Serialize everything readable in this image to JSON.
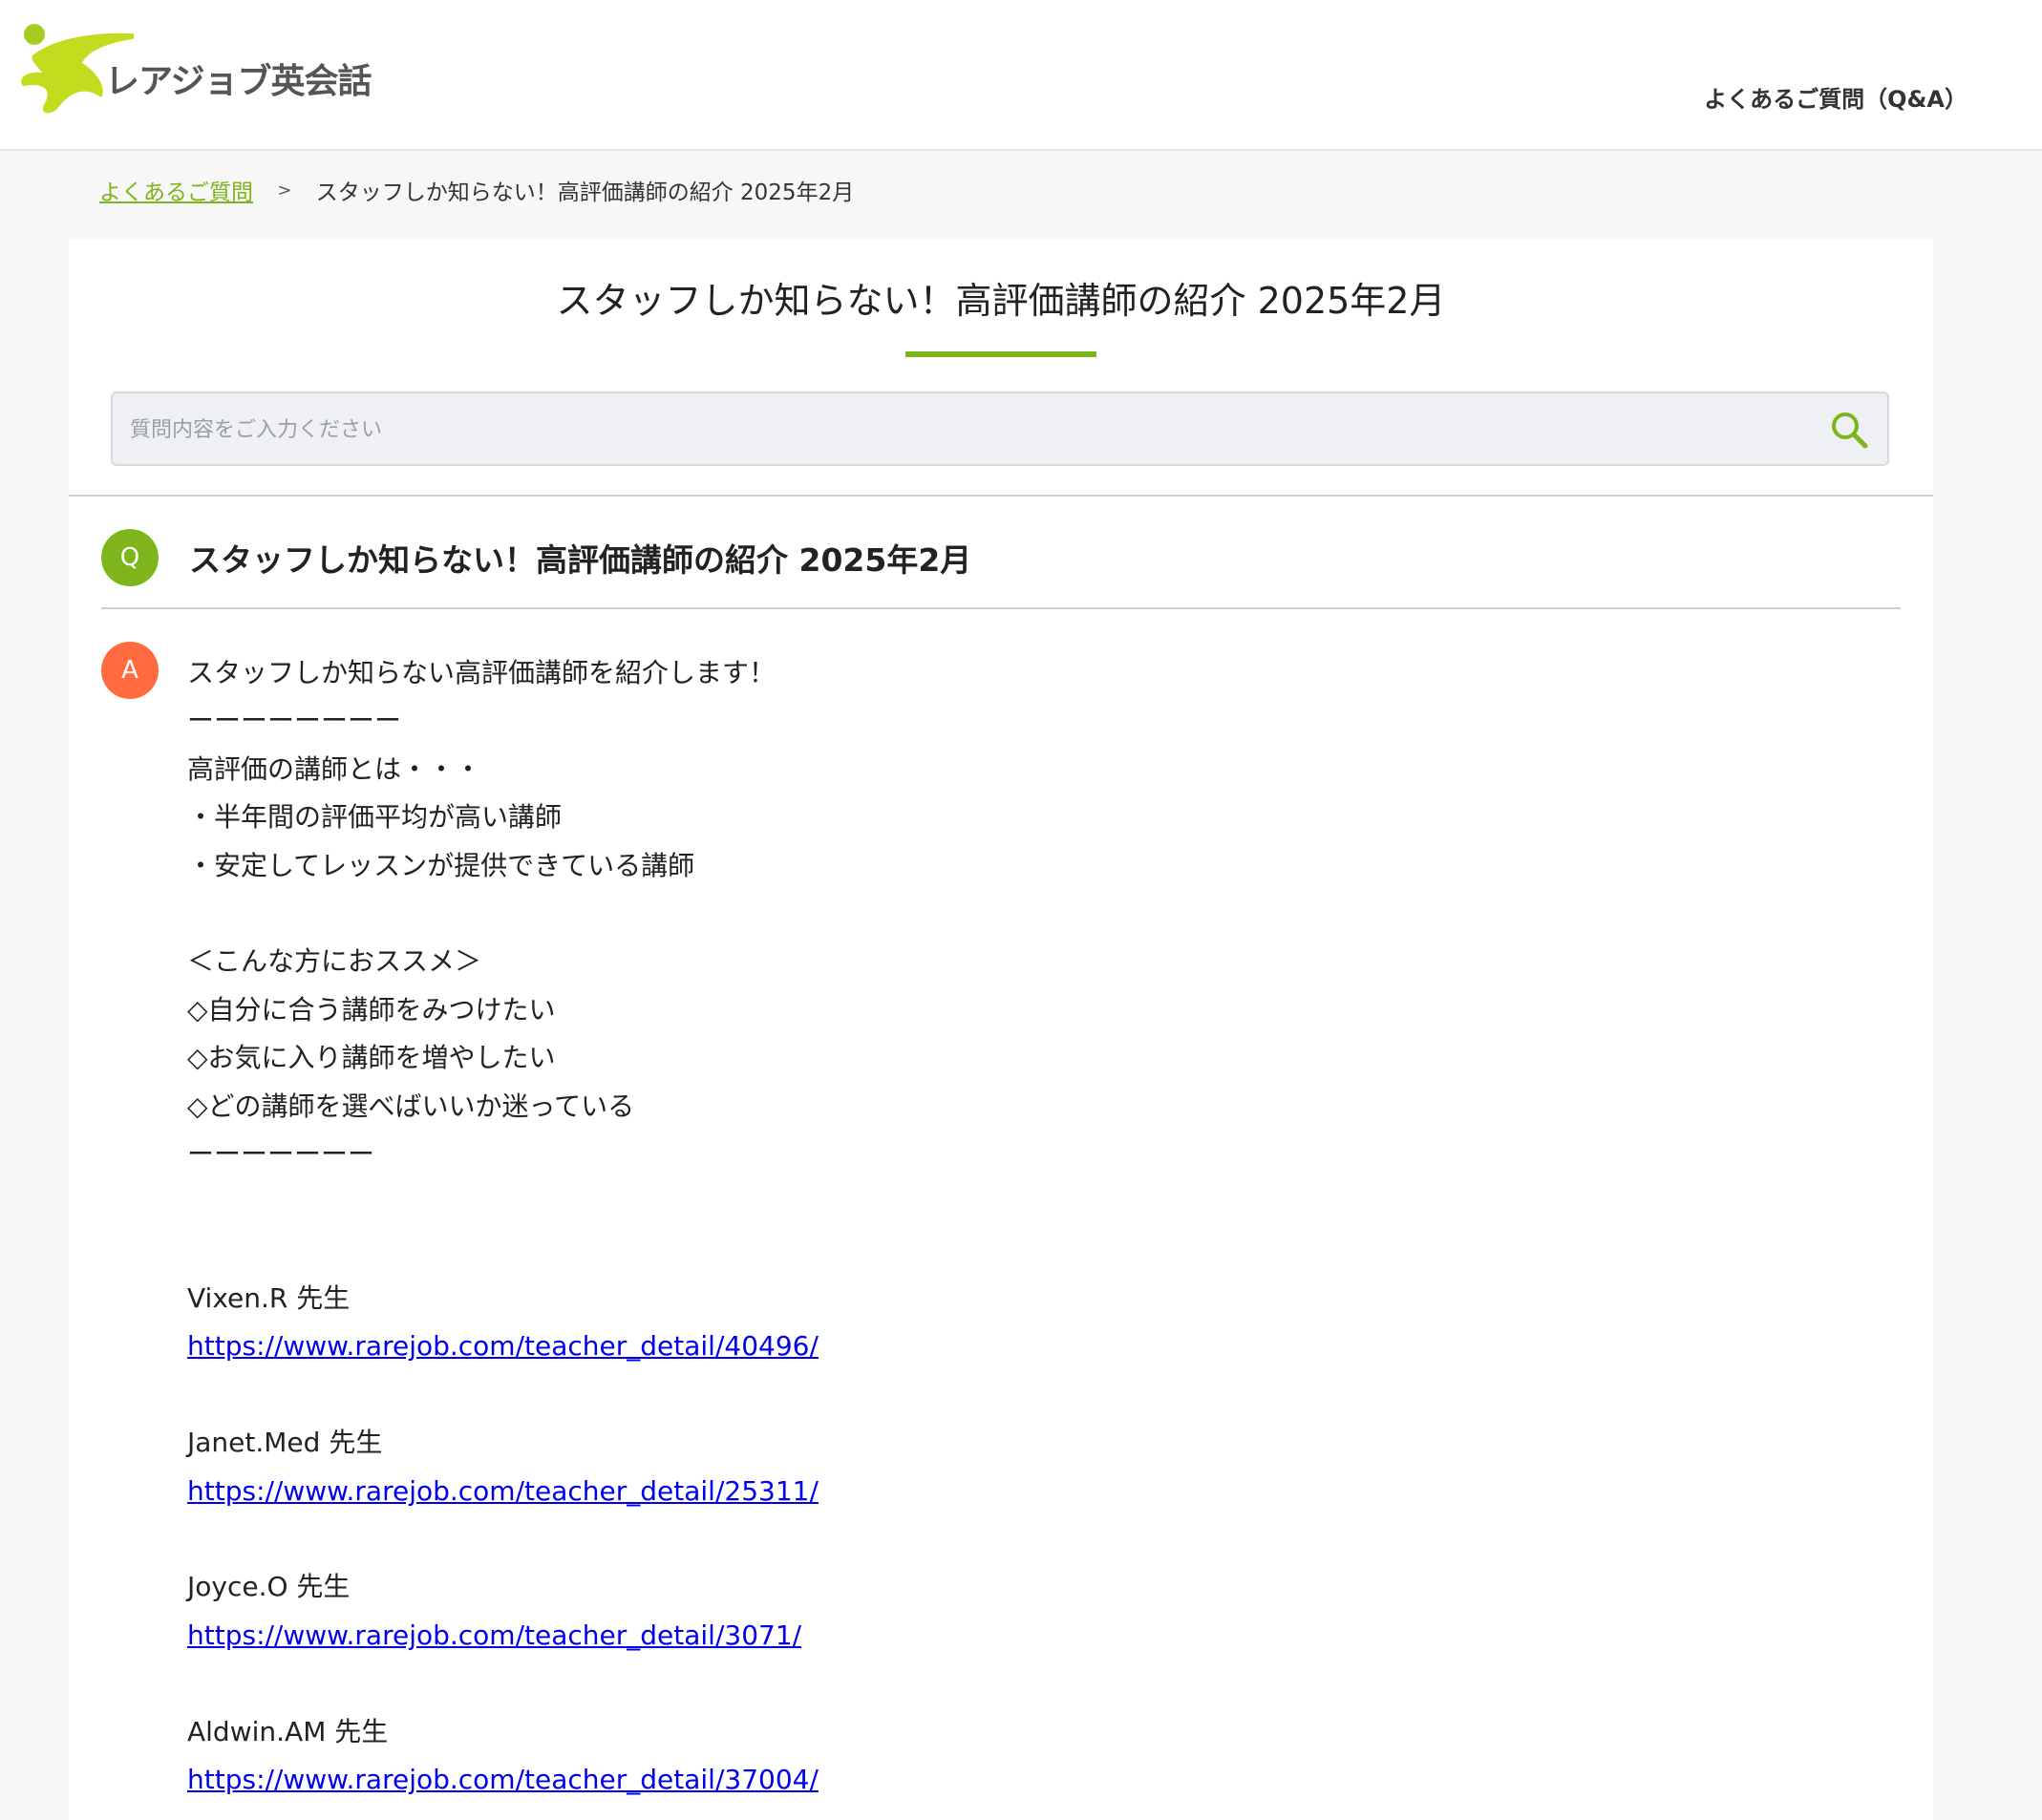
{
  "header": {
    "logo_text": "レアジョブ英会話",
    "nav_link": "よくあるご質問（Q&A）"
  },
  "breadcrumb": {
    "home": "よくあるご質問",
    "separator": ">",
    "current": "スタッフしか知らない！高評価講師の紹介 2025年2月"
  },
  "page": {
    "title": "スタッフしか知らない！高評価講師の紹介 2025年2月"
  },
  "search": {
    "placeholder": "質問内容をご入力ください",
    "value": ""
  },
  "question": {
    "badge": "Q",
    "title": "スタッフしか知らない！高評価講師の紹介 2025年2月"
  },
  "answer": {
    "badge": "A",
    "intro": "スタッフしか知らない高評価講師を紹介します！",
    "rule1": "ーーーーーーーー",
    "def_heading": "高評価の講師とは・・・",
    "def_1": "・半年間の評価平均が高い講師",
    "def_2": "・安定してレッスンが提供できている講師",
    "rec_heading": "＜こんな方におススメ＞",
    "rec_1": "◇自分に合う講師をみつけたい",
    "rec_2": "◇お気に入り講師を増やしたい",
    "rec_3": "◇どの講師を選べばいいか迷っている",
    "rule2": "ーーーーーーー",
    "teachers": [
      {
        "name": "Vixen.R 先生",
        "url": "https://www.rarejob.com/teacher_detail/40496/"
      },
      {
        "name": "Janet.Med 先生",
        "url": "https://www.rarejob.com/teacher_detail/25311/"
      },
      {
        "name": "Joyce.O 先生",
        "url": "https://www.rarejob.com/teacher_detail/3071/"
      },
      {
        "name": "Aldwin.AM 先生",
        "url": "https://www.rarejob.com/teacher_detail/37004/"
      }
    ]
  },
  "colors": {
    "accent_green": "#7db51b",
    "answer_orange": "#ff6b3d",
    "link_blue": "#0000ee"
  }
}
